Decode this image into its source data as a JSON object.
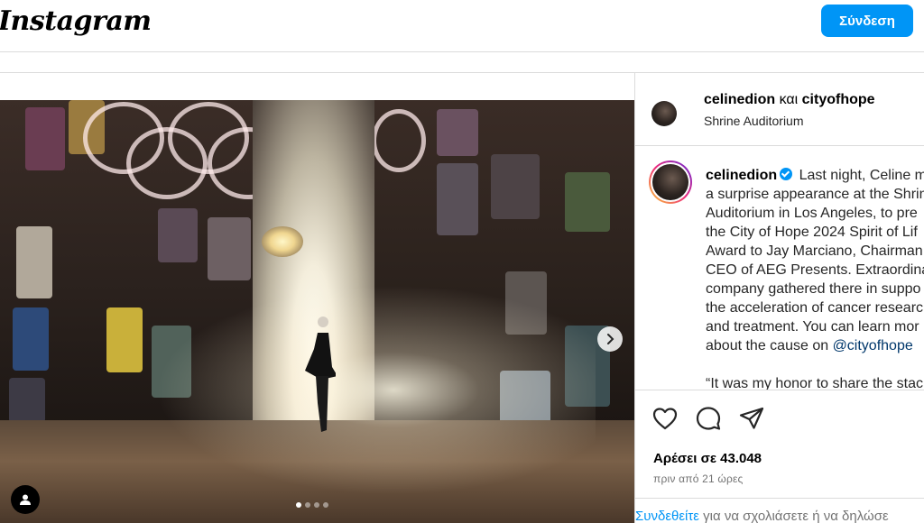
{
  "header": {
    "logo": "Instagram",
    "login_label": "Σύνδεση"
  },
  "post": {
    "owners": {
      "primary": "celinedion",
      "conjunction": "και",
      "secondary": "cityofhope"
    },
    "location": "Shrine Auditorium",
    "caption": {
      "username": "celinedion",
      "lines": [
        "Last night, Celine m",
        "a surprise appearance at the Shrin",
        "Auditorium in Los Angeles, to pre",
        "the City of Hope 2024 Spirit of Lif",
        "Award to Jay Marciano, Chairman",
        "CEO of AEG Presents. Extraordina",
        "company gathered there in suppo",
        "the acceleration of cancer researc",
        "and treatment. You can learn mor"
      ],
      "last_line_prefix": "about the cause on ",
      "mention": "@cityofhope",
      "quote_line": "“It was my honor to share the stac"
    },
    "likes": "Αρέσει σε 43.048",
    "time_ago": "πριν από 21 ώρες",
    "comment_prompt": {
      "link": "Συνδεθείτε",
      "rest": " για να σχολιάσετε ή να δηλώσε"
    },
    "carousel": {
      "total": 4,
      "active_index": 0
    }
  },
  "icons": {
    "like": "heart-icon",
    "comment": "comment-icon",
    "share": "share-icon",
    "next": "chevron-right-icon",
    "tags": "user-tag-icon",
    "verified": "verified-badge-icon"
  },
  "colors": {
    "accent": "#0095f6",
    "mention": "#00376b",
    "muted": "#737373"
  }
}
